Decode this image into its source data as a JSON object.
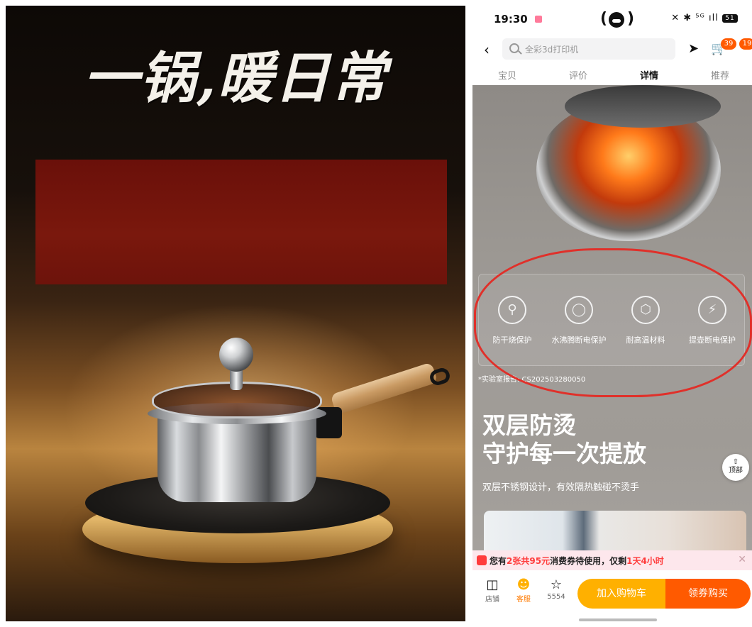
{
  "poster": {
    "title": "一锅,暖日常"
  },
  "status": {
    "time": "19:30",
    "right_icons": "✕ ✱ ⁵ᴳ ıll",
    "battery": "51"
  },
  "navbar": {
    "search_placeholder": "全彩3d打印机",
    "badge_cart": "39",
    "badge_msg": "19"
  },
  "tabs": [
    {
      "label": "宝贝"
    },
    {
      "label": "评价"
    },
    {
      "label": "详情"
    },
    {
      "label": "推荐"
    }
  ],
  "features": [
    {
      "label": "防干烧保护",
      "icon": "flame-icon"
    },
    {
      "label": "水沸腾断电保护",
      "icon": "droplet-icon"
    },
    {
      "label": "耐高温材料",
      "icon": "hexagon-icon"
    },
    {
      "label": "提壶断电保护",
      "icon": "lightning-icon"
    }
  ],
  "report": "*实验室报告: CS202503280050",
  "headline": {
    "line1": "双层防烫",
    "line2": "守护每一次提放",
    "subtitle": "双层不锈钢设计，有效隔热触碰不烫手"
  },
  "top_button": "顶部",
  "coupon": {
    "prefix": "您有",
    "count": "2张共95元",
    "middle": "消费券待使用，仅剩",
    "remaining": "1天4小时"
  },
  "actions": {
    "store": "店铺",
    "service": "客服",
    "favorites": "5554",
    "add_to_cart": "加入购物车",
    "buy": "领券购买"
  },
  "colors": {
    "accent_orange": "#ff5a00",
    "accent_yellow": "#ffb000",
    "annotation_red": "#e0302a"
  }
}
